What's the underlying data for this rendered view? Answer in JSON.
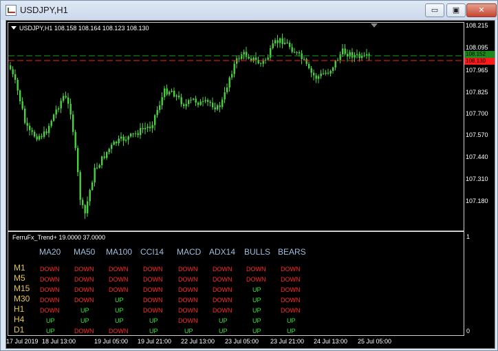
{
  "window": {
    "title": "USDJPY,H1",
    "minimize_glyph": "▭",
    "maximize_glyph": "▣",
    "close_glyph": "✕"
  },
  "chart": {
    "info": "USDJPY,H1  108.158 108.164 108.123 108.130",
    "colors": {
      "candle": "#49d23f",
      "ask_line": "#1f9a1f",
      "bid_line": "#ff2020",
      "bid_tag": "#ff1a1a",
      "ask_tag": "#1d8a1d"
    },
    "price_labels": [
      "108.215",
      "108.095",
      "107.965",
      "107.825",
      "107.700",
      "107.570",
      "107.440",
      "107.310",
      "107.180"
    ],
    "ask_tag": "108.152",
    "bid_tag": "108.130",
    "time_labels": [
      "17 Jul 2019",
      "18 Jul 13:00",
      "19 Jul 05:00",
      "19 Jul 21:00",
      "22 Jul 13:00",
      "23 Jul 05:00",
      "23 Jul 21:00",
      "24 Jul 13:00",
      "25 Jul 05:00"
    ]
  },
  "indicator": {
    "title": "FerruFx_Trend+ 19.0000 37.0000",
    "scale_top": "1",
    "scale_bottom": "0",
    "columns": [
      "MA20",
      "MA50",
      "MA100",
      "CCI14",
      "MACD",
      "ADX14",
      "BULLS",
      "BEARS"
    ],
    "rows": [
      {
        "tf": "M1",
        "cells": [
          "DOWN",
          "DOWN",
          "DOWN",
          "DOWN",
          "DOWN",
          "DOWN",
          "DOWN",
          "DOWN"
        ]
      },
      {
        "tf": "M5",
        "cells": [
          "DOWN",
          "DOWN",
          "DOWN",
          "DOWN",
          "DOWN",
          "DOWN",
          "DOWN",
          "DOWN"
        ]
      },
      {
        "tf": "M15",
        "cells": [
          "DOWN",
          "DOWN",
          "DOWN",
          "DOWN",
          "DOWN",
          "DOWN",
          "UP",
          "DOWN"
        ]
      },
      {
        "tf": "M30",
        "cells": [
          "DOWN",
          "DOWN",
          "UP",
          "DOWN",
          "DOWN",
          "DOWN",
          "UP",
          "DOWN"
        ]
      },
      {
        "tf": "H1",
        "cells": [
          "DOWN",
          "UP",
          "UP",
          "DOWN",
          "DOWN",
          "DOWN",
          "UP",
          "DOWN"
        ]
      },
      {
        "tf": "H4",
        "cells": [
          "UP",
          "UP",
          "UP",
          "UP",
          "DOWN",
          "UP",
          "UP",
          "UP"
        ]
      },
      {
        "tf": "D1",
        "cells": [
          "UP",
          "DOWN",
          "DOWN",
          "UP",
          "UP",
          "UP",
          "UP",
          "UP"
        ]
      }
    ],
    "colors": {
      "up": "#33e633",
      "down": "#ff2a2a"
    }
  }
}
